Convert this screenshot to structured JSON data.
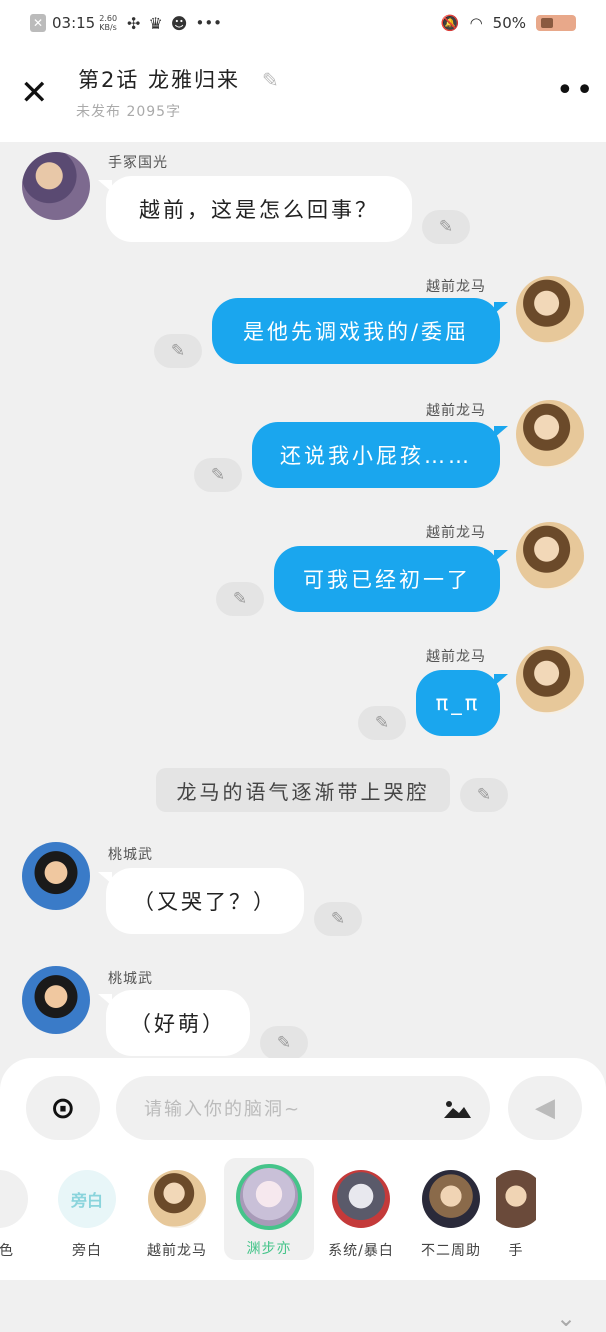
{
  "status": {
    "time": "03:15",
    "speed_top": "2.60",
    "speed_bottom": "KB/s",
    "more": "•••",
    "battery": "50%"
  },
  "header": {
    "title": "第2话  龙雅归来",
    "subtitle": "未发布  2095字"
  },
  "messages": [
    {
      "speaker": "手冢国光",
      "text": "越前，这是怎么回事？"
    },
    {
      "speaker": "越前龙马",
      "text": "是他先调戏我的/委屈"
    },
    {
      "speaker": "越前龙马",
      "text": "还说我小屁孩……"
    },
    {
      "speaker": "越前龙马",
      "text": "可我已经初一了"
    },
    {
      "speaker": "越前龙马",
      "text": "π_π"
    },
    {
      "narration": "龙马的语气逐渐带上哭腔"
    },
    {
      "speaker": "桃城武",
      "text": "（又哭了？）"
    },
    {
      "speaker": "桃城武",
      "text": "（好萌）"
    }
  ],
  "composer": {
    "placeholder": "请输入你的脑洞~"
  },
  "characters": [
    {
      "label": "角色"
    },
    {
      "label": "旁白",
      "avatar_text": "旁白"
    },
    {
      "label": "越前龙马"
    },
    {
      "label": "渊步亦"
    },
    {
      "label": "系统/暴白"
    },
    {
      "label": "不二周助"
    },
    {
      "label": "手"
    }
  ],
  "colors": {
    "accent": "#1aa6ee",
    "selected": "#45c48a"
  }
}
